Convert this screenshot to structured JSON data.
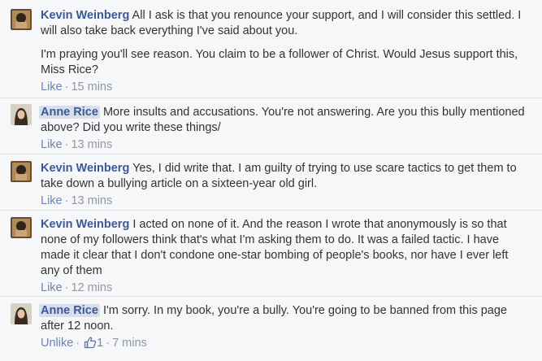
{
  "comments": [
    {
      "author": "Kevin Weinberg",
      "paragraphs": [
        "All I ask is that you renounce your support, and I will consider this settled. I will also take back everything I've said about you.",
        "I'm praying you'll see reason. You claim to be a follower of Christ. Would Jesus support this, Miss Rice?"
      ],
      "action": "Like",
      "time": "15 mins"
    },
    {
      "author": "Anne Rice",
      "paragraphs": [
        "More insults and accusations. You're not answering. Are you this bully mentioned above? Did you write these things/"
      ],
      "action": "Like",
      "time": "13 mins"
    },
    {
      "author": "Kevin Weinberg",
      "paragraphs": [
        "Yes, I did write that. I am guilty of trying to use scare tactics to get them to take down a bullying article on a sixteen-year old girl."
      ],
      "action": "Like",
      "time": "13 mins"
    },
    {
      "author": "Kevin Weinberg",
      "paragraphs": [
        "I acted on none of it. And the reason I wrote that anonymously is so that none of my followers think that's what I'm asking them to do. It was a failed tactic. I have made it clear that I don't condone one-star bombing of people's books, nor have I ever left any of them"
      ],
      "action": "Like",
      "time": "12 mins"
    },
    {
      "author": "Anne Rice",
      "paragraphs": [
        "I'm sorry. In my book, you're a bully. You're going to be banned from this page after 12 noon."
      ],
      "action": "Unlike",
      "likes": "1",
      "time": "7 mins"
    }
  ],
  "colors": {
    "author": "#3b5998",
    "link": "#6d84b4",
    "meta": "#9197a3",
    "highlight": "#d8dfea"
  },
  "icons": {
    "like": "thumbs-up-icon"
  }
}
